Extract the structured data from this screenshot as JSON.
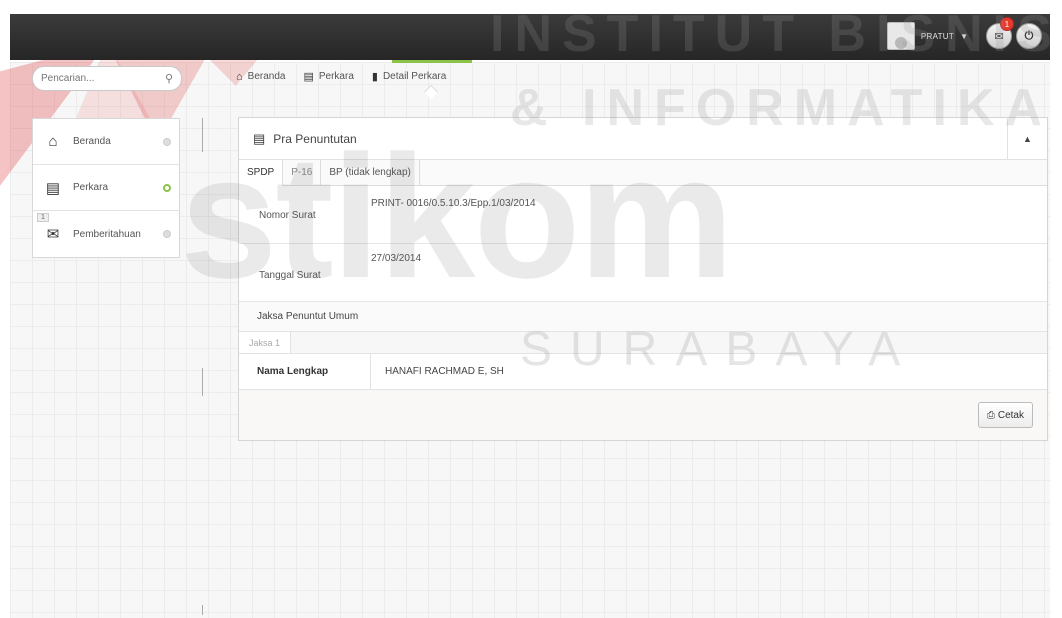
{
  "topbar": {
    "username": "PRATUT",
    "notification_count": "1",
    "icons": [
      "avatar",
      "mail-icon",
      "power-icon"
    ]
  },
  "search": {
    "placeholder": "Pencarian..."
  },
  "breadcrumb": {
    "items": [
      {
        "label": "Beranda",
        "icon": "home-icon"
      },
      {
        "label": "Perkara",
        "icon": "clipboard-icon"
      },
      {
        "label": "Detail Perkara",
        "icon": "document-icon"
      }
    ]
  },
  "sidebar": {
    "badge": "1",
    "items": [
      {
        "label": "Beranda",
        "icon": "home-icon"
      },
      {
        "label": "Perkara",
        "icon": "clipboard-icon"
      },
      {
        "label": "Pemberitahuan",
        "icon": "mail-icon"
      }
    ]
  },
  "panel": {
    "title": "Pra Penuntutan",
    "tabs": [
      "SPDP",
      "P-16",
      "BP (tidak lengkap)"
    ],
    "fields": [
      {
        "label": "Nomor Surat",
        "value": "PRINT- 0016/0.5.10.3/Epp.1/03/2014"
      },
      {
        "label": "Tanggal Surat",
        "value": "27/03/2014"
      }
    ],
    "section_title": "Jaksa Penuntut Umum",
    "subtabs": [
      "Jaksa 1"
    ],
    "name_label": "Nama Lengkap",
    "name_value": "HANAFI RACHMAD E, SH",
    "print_button": "Cetak"
  },
  "watermark": {
    "line1": "INSTITUT BISNIS",
    "line2": "& INFORMATIKA",
    "brand": "stikom",
    "city": "SURABAYA"
  }
}
